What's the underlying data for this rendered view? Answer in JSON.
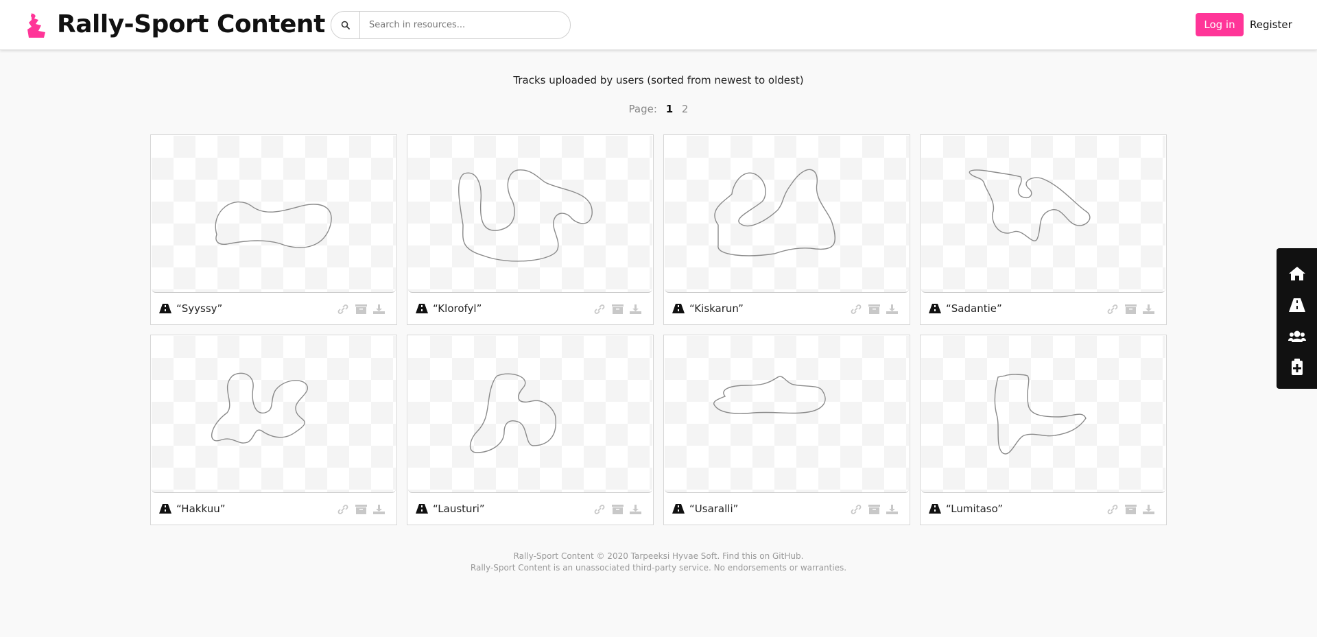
{
  "header": {
    "title": "Rally-Sport Content",
    "search": {
      "placeholder": "Search in resources...",
      "value": ""
    },
    "login_label": "Log in",
    "register_label": "Register",
    "accent_color": "#ff3598"
  },
  "main": {
    "subtitle": "Tracks uploaded by users (sorted from newest to oldest)",
    "pagination": {
      "label": "Page:",
      "pages": [
        "1",
        "2"
      ],
      "current": "1"
    }
  },
  "cards": [
    {
      "title": "“Syyssy”"
    },
    {
      "title": "“Klorofyl”"
    },
    {
      "title": "“Kiskarun”"
    },
    {
      "title": "“Sadantie”"
    },
    {
      "title": "“Hakkuu”"
    },
    {
      "title": "“Lausturi”"
    },
    {
      "title": "“Usaralli”"
    },
    {
      "title": "“Lumitaso”"
    }
  ],
  "card_icons": [
    "road-icon",
    "link-icon",
    "box-icon",
    "download-icon"
  ],
  "side_menu": [
    "home-icon",
    "road-icon",
    "users-icon",
    "clipboard-plus-icon"
  ],
  "footer": {
    "line1": "Rally-Sport Content © 2020 Tarpeeksi Hyvae Soft. Find this on GitHub.",
    "line2": "Rally-Sport Content is an unassociated third-party service. No endorsements or warranties."
  }
}
